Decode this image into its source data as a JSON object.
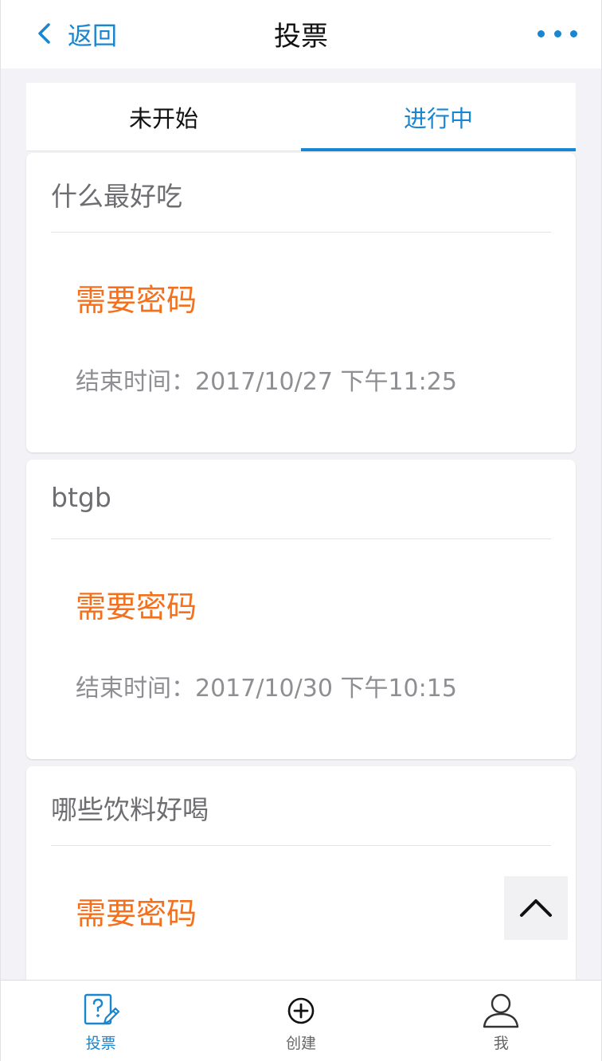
{
  "navbar": {
    "back_label": "返回",
    "title": "投票"
  },
  "tabs": [
    {
      "label": "未开始",
      "active": false
    },
    {
      "label": "进行中",
      "active": true
    }
  ],
  "cards": [
    {
      "title": "什么最好吃",
      "badge": "需要密码",
      "end_time": "结束时间：2017/10/27 下午11:25"
    },
    {
      "title": "btgb",
      "badge": "需要密码",
      "end_time": "结束时间：2017/10/30 下午10:15"
    },
    {
      "title": "哪些饮料好喝",
      "badge": "需要密码",
      "end_time": ""
    }
  ],
  "tabbar": {
    "items": [
      {
        "label": "投票",
        "icon": "vote-icon",
        "active": true
      },
      {
        "label": "创建",
        "icon": "plus-circle-icon",
        "active": false
      },
      {
        "label": "我",
        "icon": "user-icon",
        "active": false
      }
    ]
  },
  "colors": {
    "accent": "#1a86d0",
    "badge": "#f4701c",
    "background": "#f3f3f7"
  }
}
